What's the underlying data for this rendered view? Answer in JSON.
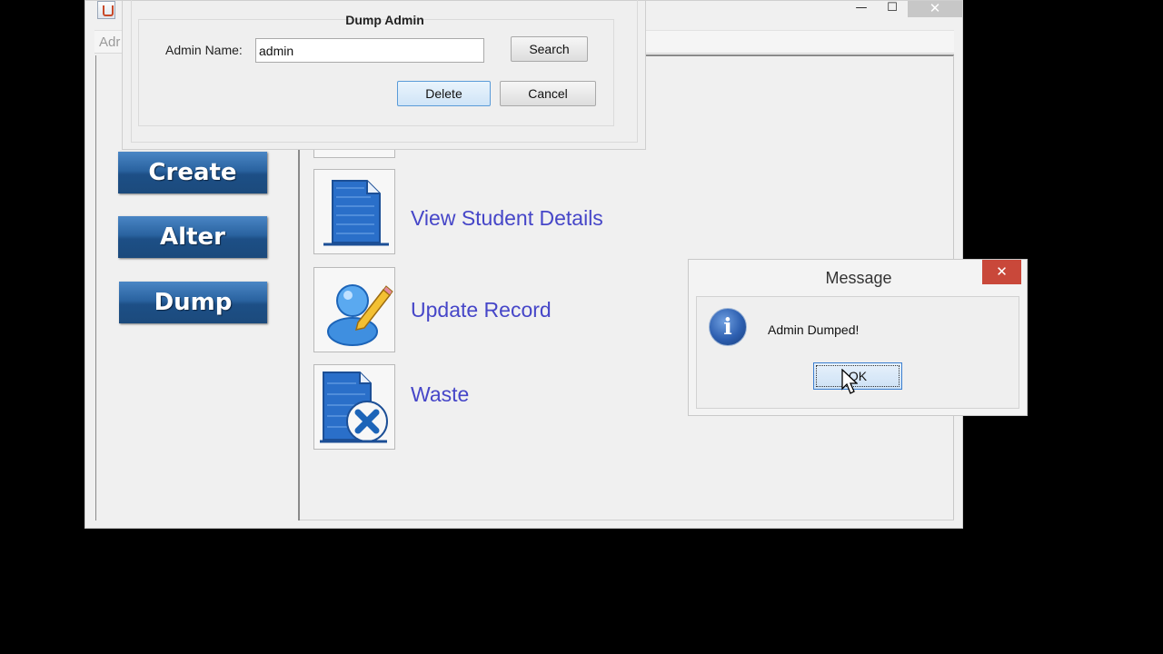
{
  "main_window": {
    "menu_partial": "Adr",
    "controls": {
      "minimize": "—",
      "maximize": "☐",
      "close": "✕"
    }
  },
  "sidebar": {
    "buttons": [
      {
        "label": "Create"
      },
      {
        "label": "Alter"
      },
      {
        "label": "Dump"
      }
    ]
  },
  "actions": [
    {
      "label": "View Student Details",
      "icon": "document-icon"
    },
    {
      "label": "Update Record",
      "icon": "user-edit-icon"
    },
    {
      "label": "Waste",
      "icon": "document-delete-icon"
    }
  ],
  "dump_dialog": {
    "title": "Dump Admin",
    "admin_name_label": "Admin Name:",
    "admin_name_value": "admin",
    "search_label": "Search",
    "delete_label": "Delete",
    "cancel_label": "Cancel"
  },
  "message_dialog": {
    "title": "Message",
    "close_glyph": "✕",
    "icon": "info-icon",
    "info_glyph": "i",
    "text": "Admin Dumped!",
    "ok_label": "OK"
  },
  "colors": {
    "button_blue": "#1d4f86",
    "link_text": "#4646c8",
    "close_red": "#c9483a"
  }
}
